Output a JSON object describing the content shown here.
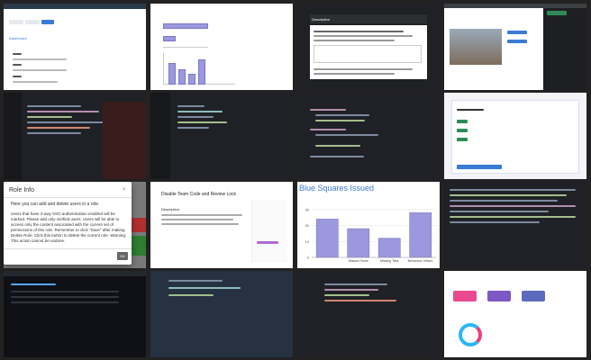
{
  "modal": {
    "title": "Role Info",
    "close_glyph": "×",
    "intro": "Here you can add and delete users in a role.",
    "para1": "Users that have 2-way SSO authentication enabled will be marked. Please add only verified users. Users will be able to access only the content associated with the current set of permissions of this role. Remember to click \"Save\" after making changes to this.",
    "para2": "Delete Role: Click this button to delete the current role. Warning: This action cannot be undone.",
    "ok_label": "OK"
  },
  "chart_tile": {
    "title": "Blue Squares Issued",
    "chart_data": {
      "type": "bar",
      "title": "Blue Squares Issued",
      "categories": [
        "",
        "Missed Hours",
        "Missing Task",
        "Behaviour Infract."
      ],
      "values": [
        24,
        18,
        12,
        28
      ],
      "ylim": [
        0,
        35
      ]
    }
  },
  "tile_texts": {
    "t1_title": "Dashboard",
    "t3_title": "Description",
    "t10_title": "Disable Team Code and Review Lock",
    "t10_subtitle": "Description",
    "t11_y_labels": [
      "30",
      "20",
      "10",
      "0"
    ]
  },
  "colors": {
    "accent": "#3a7bd5",
    "bar": "#9b98dd",
    "green": "#2e8b57",
    "red": "#d83a3a"
  }
}
